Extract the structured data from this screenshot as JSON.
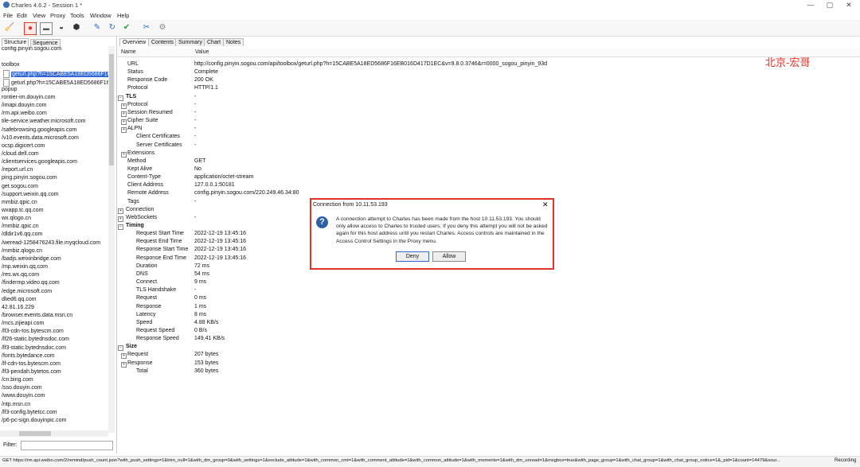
{
  "window": {
    "title": "Charles 4.6.2 - Session 1 *",
    "controls": [
      "—",
      "▢",
      "✕"
    ]
  },
  "menu": [
    "File",
    "Edit",
    "View",
    "Proxy",
    "Tools",
    "Window",
    "Help"
  ],
  "toolbar": {
    "icons": [
      {
        "name": "broom-icon",
        "glyph": "🧹",
        "color": "#d89a1a"
      },
      {
        "name": "record-icon",
        "glyph": "●",
        "color": "#e0342a"
      },
      {
        "name": "throttle-icon",
        "glyph": "▬",
        "color": "#555555"
      },
      {
        "name": "turtle-icon",
        "glyph": "◒",
        "color": "#333333"
      },
      {
        "name": "breakpoint-icon",
        "glyph": "⬢",
        "color": "#333333"
      },
      {
        "name": "pen-icon",
        "glyph": "✎",
        "color": "#2b6fc7"
      },
      {
        "name": "refresh-icon",
        "glyph": "↻",
        "color": "#2b6fc7"
      },
      {
        "name": "check-icon",
        "glyph": "✔",
        "color": "#2e9a2e"
      },
      {
        "name": "tools-icon",
        "glyph": "✂",
        "color": "#2b6fc7"
      },
      {
        "name": "settings-icon",
        "glyph": "⚙",
        "color": "#888888"
      }
    ]
  },
  "left_panel": {
    "tabs": [
      "Structure",
      "Sequence"
    ],
    "tree": [
      "config.pinyin.sogou.com",
      "",
      "toolbox",
      "geturl.php?h=15CABE5A18ED5686F16",
      "geturl.php?h=15CABE5A18ED5686F16",
      "popup",
      "rontier-im.douyin.com",
      "/imapi.douyin.com",
      "/rm.api.weibo.com",
      "tile-service.weather.microsoft.com",
      "/safebrowsing.googleapis.com",
      "/v10.events.data.microsoft.com",
      "ocsp.digicert.com",
      "/cloud.dell.com",
      "/clientservices.googleapis.com",
      "/report.url.cn",
      "ping.pinyin.sogou.com",
      "get.sogou.com",
      "/support.weixin.qq.com",
      "mmbiz.qpic.cn",
      "wxapp.tc.qq.com",
      "wx.qlogo.cn",
      "/mmbiz.qpic.cn",
      "/dldir1v6.qq.com",
      "/weread-1258476243.file.myqcloud.com",
      "/mmbiz.qlogo.cn",
      "/badjs.weixinbridge.com",
      "/mp.weixin.qq.com",
      "/res.wx.qq.com",
      "/findermp.video.qq.com",
      "/edge.microsoft.com",
      "dlied6.qq.com",
      "42.81.16.229",
      "/browser.events.data.msn.cn",
      "/mcs.zijieapi.com",
      "/lf3-cdn-tos.bytescm.com",
      "/lf26-static.bytednsdoc.com",
      "/lf3-static.bytednsdoc.com",
      "/fonts.bytedance.com",
      "/lf-cdn-tos.bytescm.com",
      "/lf3-pendah.bytetos.com",
      "/cn.bing.com",
      "/sso.douyin.com",
      "/www.douyin.com",
      "/ntp.msn.cn",
      "/lf3-config.bytetcc.com",
      "/p6-pc-sign.douyinpic.com"
    ],
    "selected_index": 3,
    "filter_label": "Filter:"
  },
  "right_panel": {
    "tabs": [
      "Overview",
      "Contents",
      "Summary",
      "Chart",
      "Notes"
    ],
    "columns": [
      "Name",
      "Value"
    ],
    "rows": [
      {
        "name": "URL",
        "value": "http://config.pinyin.sogou.com/api/toolbox/geturl.php?h=15CABE5A18ED5686F16EB016D417D1EC&v=9.8.0.3746&r=0000_sogou_pinyin_93d",
        "level": 1,
        "exp": ""
      },
      {
        "name": "Status",
        "value": "Complete",
        "level": 1,
        "exp": ""
      },
      {
        "name": "Response Code",
        "value": "200 OK",
        "level": 1,
        "exp": ""
      },
      {
        "name": "Protocol",
        "value": "HTTP/1.1",
        "level": 1,
        "exp": ""
      },
      {
        "name": "TLS",
        "value": "-",
        "level": 0,
        "exp": "−",
        "bold": true
      },
      {
        "name": "Protocol",
        "value": "-",
        "level": 1,
        "exp": "+"
      },
      {
        "name": "Session Resumed",
        "value": "-",
        "level": 1,
        "exp": "+"
      },
      {
        "name": "Cipher Suite",
        "value": "-",
        "level": 1,
        "exp": "+"
      },
      {
        "name": "ALPN",
        "value": "-",
        "level": 1,
        "exp": "+"
      },
      {
        "name": "Client Certificates",
        "value": "-",
        "level": 2,
        "exp": ""
      },
      {
        "name": "Server Certificates",
        "value": "-",
        "level": 2,
        "exp": ""
      },
      {
        "name": "Extensions",
        "value": "",
        "level": 1,
        "exp": "+"
      },
      {
        "name": "Method",
        "value": "GET",
        "level": 1,
        "exp": ""
      },
      {
        "name": "Kept Alive",
        "value": "No",
        "level": 1,
        "exp": ""
      },
      {
        "name": "Content-Type",
        "value": "application/octet-stream",
        "level": 1,
        "exp": ""
      },
      {
        "name": "Client Address",
        "value": "127.0.0.1:50181",
        "level": 1,
        "exp": ""
      },
      {
        "name": "Remote Address",
        "value": "config.pinyin.sogou.com/220.249.46.34:80",
        "level": 1,
        "exp": ""
      },
      {
        "name": "Tags",
        "value": "-",
        "level": 1,
        "exp": ""
      },
      {
        "name": "Connection",
        "value": "",
        "level": 0,
        "exp": "+"
      },
      {
        "name": "WebSockets",
        "value": "-",
        "level": 0,
        "exp": "+"
      },
      {
        "name": "Timing",
        "value": "",
        "level": 0,
        "exp": "−",
        "bold": true
      },
      {
        "name": "Request Start Time",
        "value": "2022-12-19 13:45:16",
        "level": 2,
        "exp": ""
      },
      {
        "name": "Request End Time",
        "value": "2022-12-19 13:45:16",
        "level": 2,
        "exp": ""
      },
      {
        "name": "Response Start Time",
        "value": "2022-12-19 13:45:16",
        "level": 2,
        "exp": ""
      },
      {
        "name": "Response End Time",
        "value": "2022-12-19 13:45:16",
        "level": 2,
        "exp": ""
      },
      {
        "name": "Duration",
        "value": "72 ms",
        "level": 2,
        "exp": ""
      },
      {
        "name": "DNS",
        "value": "54 ms",
        "level": 2,
        "exp": ""
      },
      {
        "name": "Connect",
        "value": "9 ms",
        "level": 2,
        "exp": ""
      },
      {
        "name": "TLS Handshake",
        "value": "-",
        "level": 2,
        "exp": ""
      },
      {
        "name": "Request",
        "value": "0 ms",
        "level": 2,
        "exp": ""
      },
      {
        "name": "Response",
        "value": "1 ms",
        "level": 2,
        "exp": ""
      },
      {
        "name": "Latency",
        "value": "8 ms",
        "level": 2,
        "exp": ""
      },
      {
        "name": "Speed",
        "value": "4.88 KB/s",
        "level": 2,
        "exp": ""
      },
      {
        "name": "Request Speed",
        "value": "0 B/s",
        "level": 2,
        "exp": ""
      },
      {
        "name": "Response Speed",
        "value": "149.41 KB/s",
        "level": 2,
        "exp": ""
      },
      {
        "name": "Size",
        "value": "",
        "level": 0,
        "exp": "−",
        "bold": true
      },
      {
        "name": "Request",
        "value": "207 bytes",
        "level": 1,
        "exp": "+"
      },
      {
        "name": "Response",
        "value": "153 bytes",
        "level": 1,
        "exp": "+"
      },
      {
        "name": "Total",
        "value": "360 bytes",
        "level": 2,
        "exp": ""
      }
    ]
  },
  "watermark": "北京-宏哥",
  "dialog": {
    "title": "Connection from 10.11.53.193",
    "message": "A connection attempt to Charles has been made from the host 10.11.53.193. You should only allow access to Charles to trusted users. If you deny this attempt you will not be asked again for this host address until you restart Charles. Access controls are maintained in the Access Control Settings in the Proxy menu.",
    "deny_label": "Deny",
    "allow_label": "Allow"
  },
  "statusbar": {
    "text": "GET https://rm.api.weibo.com/2/remind/push_count.json?with_push_settings=1&trim_null=1&with_dm_group=0&with_settings=1&exclude_attitude=1&with_common_cmt=1&with_comment_attitude=1&with_common_attitude=1&with_moments=1&with_dm_unread=1&msgbox=true&with_page_group=1&with_chat_group=1&with_chat_group_notice=1&_pid=1&count=14479&sour...",
    "recording": "Recording"
  }
}
